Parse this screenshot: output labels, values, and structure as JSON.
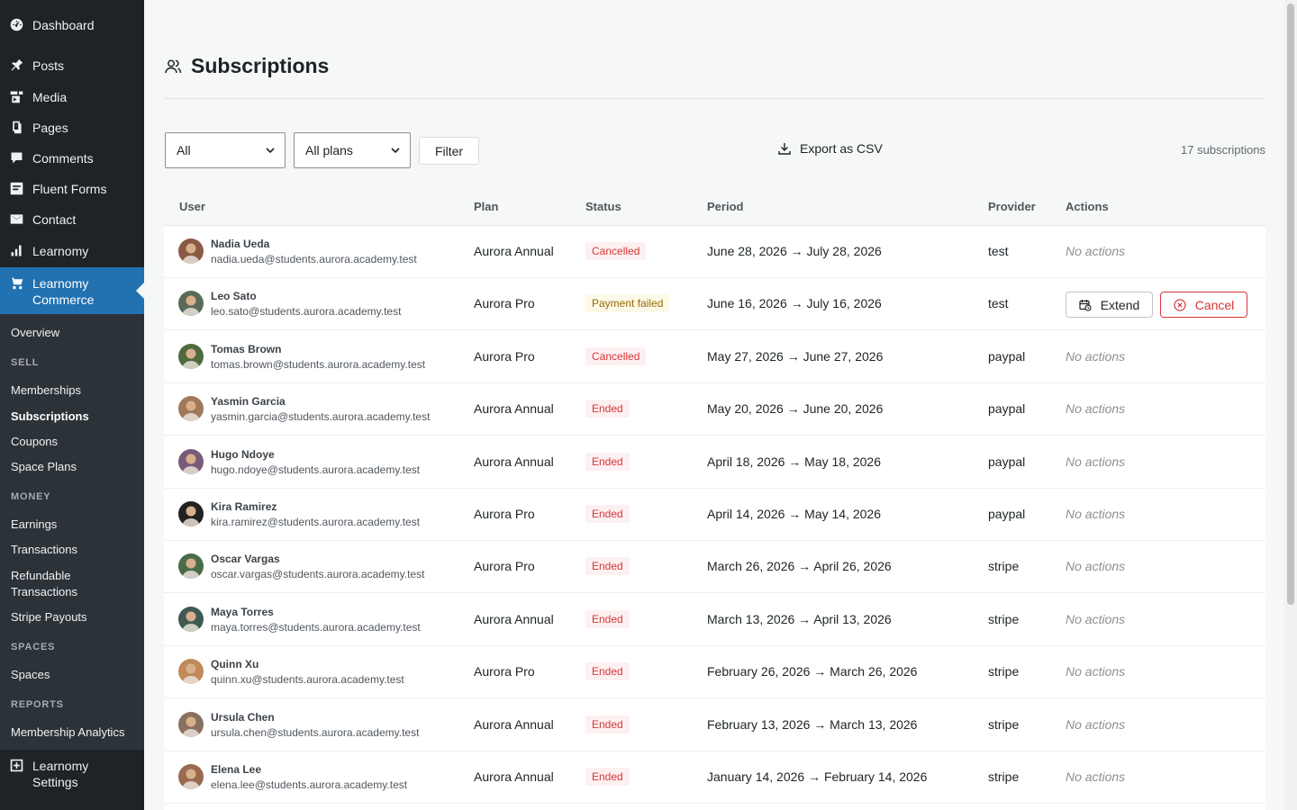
{
  "sidebar": {
    "items": [
      {
        "label": "Dashboard",
        "icon": "dashboard-icon"
      },
      {
        "label": "Posts",
        "icon": "pushpin-icon"
      },
      {
        "label": "Media",
        "icon": "media-icon"
      },
      {
        "label": "Pages",
        "icon": "pages-icon"
      },
      {
        "label": "Comments",
        "icon": "comment-bubble-icon"
      },
      {
        "label": "Fluent Forms",
        "icon": "forms-icon"
      },
      {
        "label": "Contact",
        "icon": "envelope-icon"
      },
      {
        "label": "Learnomy",
        "icon": "bar-chart-icon"
      },
      {
        "label": "Learnomy Commerce",
        "icon": "cart-icon"
      }
    ],
    "submenu": {
      "overview": "Overview",
      "sell_heading": "SELL",
      "memberships": "Memberships",
      "subscriptions": "Subscriptions",
      "coupons": "Coupons",
      "space_plans": "Space Plans",
      "money_heading": "MONEY",
      "earnings": "Earnings",
      "transactions": "Transactions",
      "refundable_1": "Refundable",
      "refundable_2": "Transactions",
      "stripe_payouts": "Stripe Payouts",
      "spaces_heading": "SPACES",
      "spaces": "Spaces",
      "reports_heading": "REPORTS",
      "membership_analytics": "Membership Analytics"
    },
    "settings": {
      "line1": "Learnomy",
      "line2": "Settings",
      "icon": "settings-plus-icon"
    }
  },
  "header": {
    "title": "Subscriptions",
    "icon": "users-icon"
  },
  "filters": {
    "status_value": "All",
    "plan_value": "All plans",
    "filter_label": "Filter",
    "export_label": "Export as CSV",
    "count": "17 subscriptions"
  },
  "table": {
    "columns": {
      "user": "User",
      "plan": "Plan",
      "status": "Status",
      "period": "Period",
      "provider": "Provider",
      "actions": "Actions"
    },
    "rows": [
      {
        "name": "Nadia Ueda",
        "email": "nadia.ueda@students.aurora.academy.test",
        "plan": "Aurora Annual",
        "status": "Cancelled",
        "status_kind": "cancelled",
        "period": "June 28, 2026 → July 28, 2026",
        "provider": "test",
        "actions": "No actions",
        "avatar_color": "#8a5a44"
      },
      {
        "name": "Leo Sato",
        "email": "leo.sato@students.aurora.academy.test",
        "plan": "Aurora Pro",
        "status": "Payment failed",
        "status_kind": "failed",
        "period": "June 16, 2026 → July 16, 2026",
        "provider": "test",
        "actions": "",
        "extend_label": "Extend",
        "cancel_label": "Cancel",
        "avatar_color": "#5a6b5a"
      },
      {
        "name": "Tomas Brown",
        "email": "tomas.brown@students.aurora.academy.test",
        "plan": "Aurora Pro",
        "status": "Cancelled",
        "status_kind": "cancelled",
        "period": "May 27, 2026 → June 27, 2026",
        "provider": "paypal",
        "actions": "No actions",
        "avatar_color": "#4d6b3f"
      },
      {
        "name": "Yasmin Garcia",
        "email": "yasmin.garcia@students.aurora.academy.test",
        "plan": "Aurora Annual",
        "status": "Ended",
        "status_kind": "ended",
        "period": "May 20, 2026 → June 20, 2026",
        "provider": "paypal",
        "actions": "No actions",
        "avatar_color": "#a0785a"
      },
      {
        "name": "Hugo Ndoye",
        "email": "hugo.ndoye@students.aurora.academy.test",
        "plan": "Aurora Annual",
        "status": "Ended",
        "status_kind": "ended",
        "period": "April 18, 2026 → May 18, 2026",
        "provider": "paypal",
        "actions": "No actions",
        "avatar_color": "#7a5a7a"
      },
      {
        "name": "Kira Ramirez",
        "email": "kira.ramirez@students.aurora.academy.test",
        "plan": "Aurora Pro",
        "status": "Ended",
        "status_kind": "ended",
        "period": "April 14, 2026 → May 14, 2026",
        "provider": "paypal",
        "actions": "No actions",
        "avatar_color": "#222222"
      },
      {
        "name": "Oscar Vargas",
        "email": "oscar.vargas@students.aurora.academy.test",
        "plan": "Aurora Pro",
        "status": "Ended",
        "status_kind": "ended",
        "period": "March 26, 2026 → April 26, 2026",
        "provider": "stripe",
        "actions": "No actions",
        "avatar_color": "#4a6b4a"
      },
      {
        "name": "Maya Torres",
        "email": "maya.torres@students.aurora.academy.test",
        "plan": "Aurora Annual",
        "status": "Ended",
        "status_kind": "ended",
        "period": "March 13, 2026 → April 13, 2026",
        "provider": "stripe",
        "actions": "No actions",
        "avatar_color": "#3f5a52"
      },
      {
        "name": "Quinn Xu",
        "email": "quinn.xu@students.aurora.academy.test",
        "plan": "Aurora Pro",
        "status": "Ended",
        "status_kind": "ended",
        "period": "February 26, 2026 → March 26, 2026",
        "provider": "stripe",
        "actions": "No actions",
        "avatar_color": "#c08a5a"
      },
      {
        "name": "Ursula Chen",
        "email": "ursula.chen@students.aurora.academy.test",
        "plan": "Aurora Annual",
        "status": "Ended",
        "status_kind": "ended",
        "period": "February 13, 2026 → March 13, 2026",
        "provider": "stripe",
        "actions": "No actions",
        "avatar_color": "#8a7060"
      },
      {
        "name": "Elena Lee",
        "email": "elena.lee@students.aurora.academy.test",
        "plan": "Aurora Annual",
        "status": "Ended",
        "status_kind": "ended",
        "period": "January 14, 2026 → February 14, 2026",
        "provider": "stripe",
        "actions": "No actions",
        "avatar_color": "#9a6a50"
      }
    ]
  },
  "colors": {
    "sidebar_bg": "#1d2327",
    "submenu_bg": "#2c3338",
    "active": "#2271b1",
    "danger": "#d63638",
    "warning": "#996800"
  }
}
